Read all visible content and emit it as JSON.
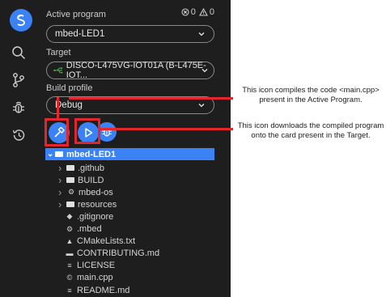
{
  "sidebar": {
    "active_program_label": "Active program",
    "status_errors": "0",
    "status_warnings": "0",
    "active_program_value": "mbed-LED1",
    "target_label": "Target",
    "target_value": "DISCO-L475VG-IOT01A (B-L475E-IOT...",
    "build_profile_label": "Build profile",
    "build_profile_value": "Debug"
  },
  "tree": {
    "root": "mbed-LED1",
    "items": [
      {
        "label": ".github",
        "kind": "folder",
        "collapsible": true
      },
      {
        "label": "BUILD",
        "kind": "folder",
        "collapsible": true
      },
      {
        "label": "mbed-os",
        "kind": "gear",
        "collapsible": true
      },
      {
        "label": "resources",
        "kind": "folder",
        "collapsible": true
      },
      {
        "label": ".gitignore",
        "kind": "diamond",
        "collapsible": false
      },
      {
        "label": ".mbed",
        "kind": "gear",
        "collapsible": false
      },
      {
        "label": "CMakeLists.txt",
        "kind": "triangle",
        "collapsible": false
      },
      {
        "label": "CONTRIBUTING.md",
        "kind": "md",
        "collapsible": false
      },
      {
        "label": "LICENSE",
        "kind": "lines",
        "collapsible": false
      },
      {
        "label": "main.cpp",
        "kind": "cpp",
        "collapsible": false
      },
      {
        "label": "README.md",
        "kind": "lines",
        "collapsible": false
      }
    ]
  },
  "annotations": {
    "build": [
      "This icon compiles the code <main.cpp>",
      "present in the Active Program."
    ],
    "flash": [
      "This icon downloads the compiled program",
      "onto the card present in the Target."
    ]
  },
  "colors": {
    "accent": "#3b82f6",
    "annotation": "#e3262c",
    "background": "#1e1e1e"
  }
}
